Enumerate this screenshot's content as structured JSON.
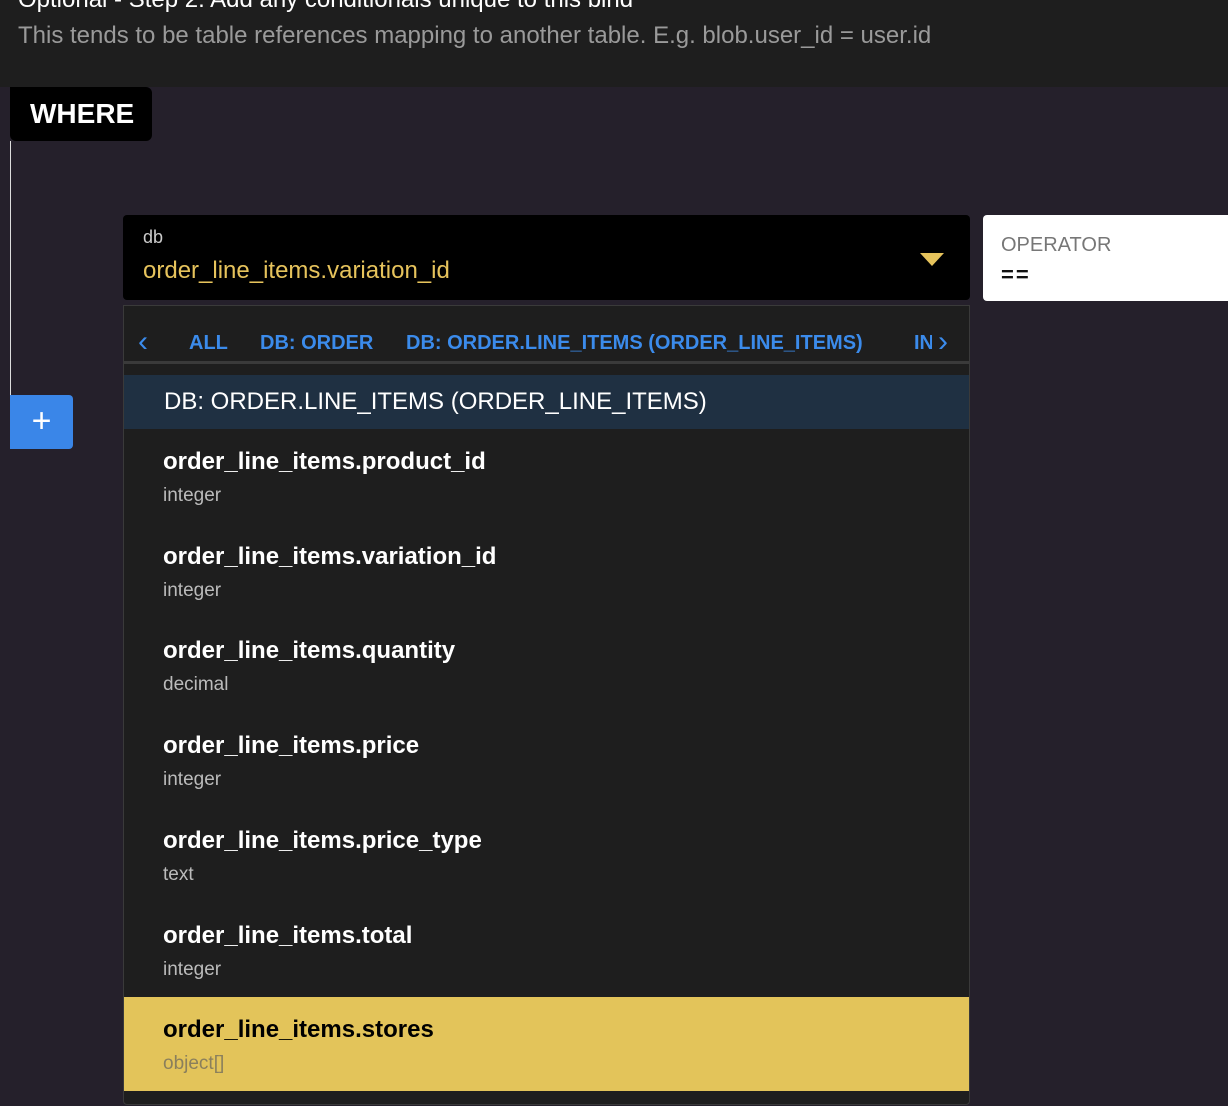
{
  "header": {
    "title": "Optional - Step 2: Add any conditionals unique to this bind",
    "subtitle": "This tends to be table references mapping to another table. E.g. blob.user_id = user.id"
  },
  "where_label": "WHERE",
  "add_button": "+",
  "field_select": {
    "label": "db",
    "value": "order_line_items.variation_id"
  },
  "operator": {
    "label": "OPERATOR",
    "value": "=="
  },
  "dropdown": {
    "tabs": [
      "ALL",
      "DB: ORDER",
      "DB: ORDER.LINE_ITEMS (ORDER_LINE_ITEMS)",
      "IN"
    ],
    "group_header": "DB: ORDER.LINE_ITEMS (ORDER_LINE_ITEMS)",
    "items": [
      {
        "name": "order_line_items.product_id",
        "type": "integer"
      },
      {
        "name": "order_line_items.variation_id",
        "type": "integer"
      },
      {
        "name": "order_line_items.quantity",
        "type": "decimal"
      },
      {
        "name": "order_line_items.price",
        "type": "integer"
      },
      {
        "name": "order_line_items.price_type",
        "type": "text"
      },
      {
        "name": "order_line_items.total",
        "type": "integer"
      },
      {
        "name": "order_line_items.stores",
        "type": "object[]",
        "highlighted": true
      }
    ]
  },
  "colors": {
    "accent_yellow": "#e3c45a",
    "link_blue": "#3b8beb",
    "add_button": "#3a86e8"
  }
}
